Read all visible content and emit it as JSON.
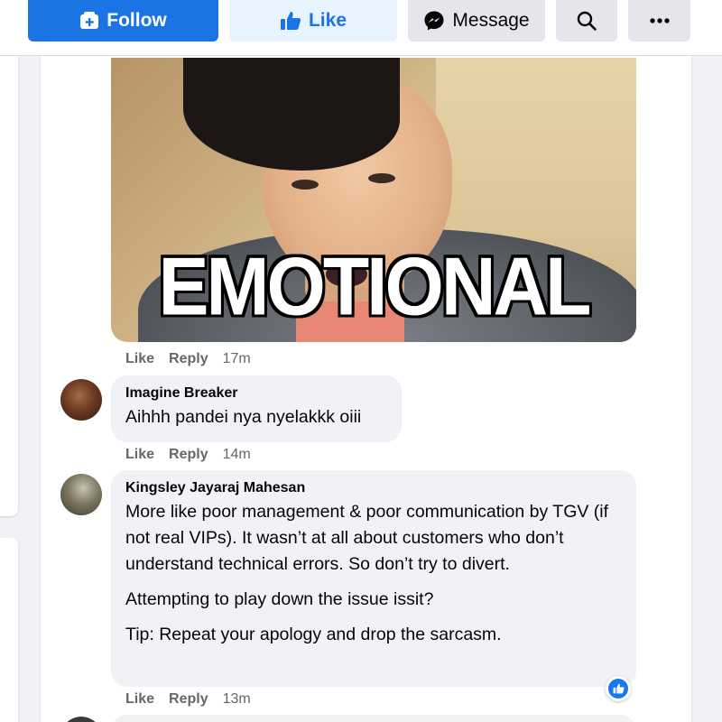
{
  "toolbar": {
    "follow_label": "Follow",
    "like_label": "Like",
    "message_label": "Message",
    "follow_icon": "add-friend-icon",
    "like_icon": "thumbs-up-icon",
    "message_icon": "messenger-icon",
    "search_icon": "search-icon",
    "more_icon": "more-options-icon"
  },
  "gif": {
    "caption": "EMOTIONAL"
  },
  "comments": [
    {
      "author": "",
      "text": "",
      "actions": {
        "like": "Like",
        "reply": "Reply",
        "time": "17m"
      }
    },
    {
      "author": "Imagine Breaker",
      "text": "Aihhh pandei nya nyelakkk oiii",
      "actions": {
        "like": "Like",
        "reply": "Reply",
        "time": "14m"
      }
    },
    {
      "author": "Kingsley Jayaraj Mahesan",
      "paragraphs": [
        "More like poor management & poor communication by TGV (if not real VIPs). It wasn’t at all about customers who don’t understand technical errors. So don’t try to divert.",
        "Attempting to play down the issue issit?",
        "Tip: Repeat your apology and drop the sarcasm."
      ],
      "actions": {
        "like": "Like",
        "reply": "Reply",
        "time": "13m"
      },
      "reaction": "like-reaction-icon"
    }
  ],
  "colors": {
    "primary": "#1b74e4",
    "like_bg": "#e7f3ff",
    "secondary_button": "#e4e6eb",
    "bubble": "#f0f2f5",
    "meta_text": "#65676b"
  }
}
